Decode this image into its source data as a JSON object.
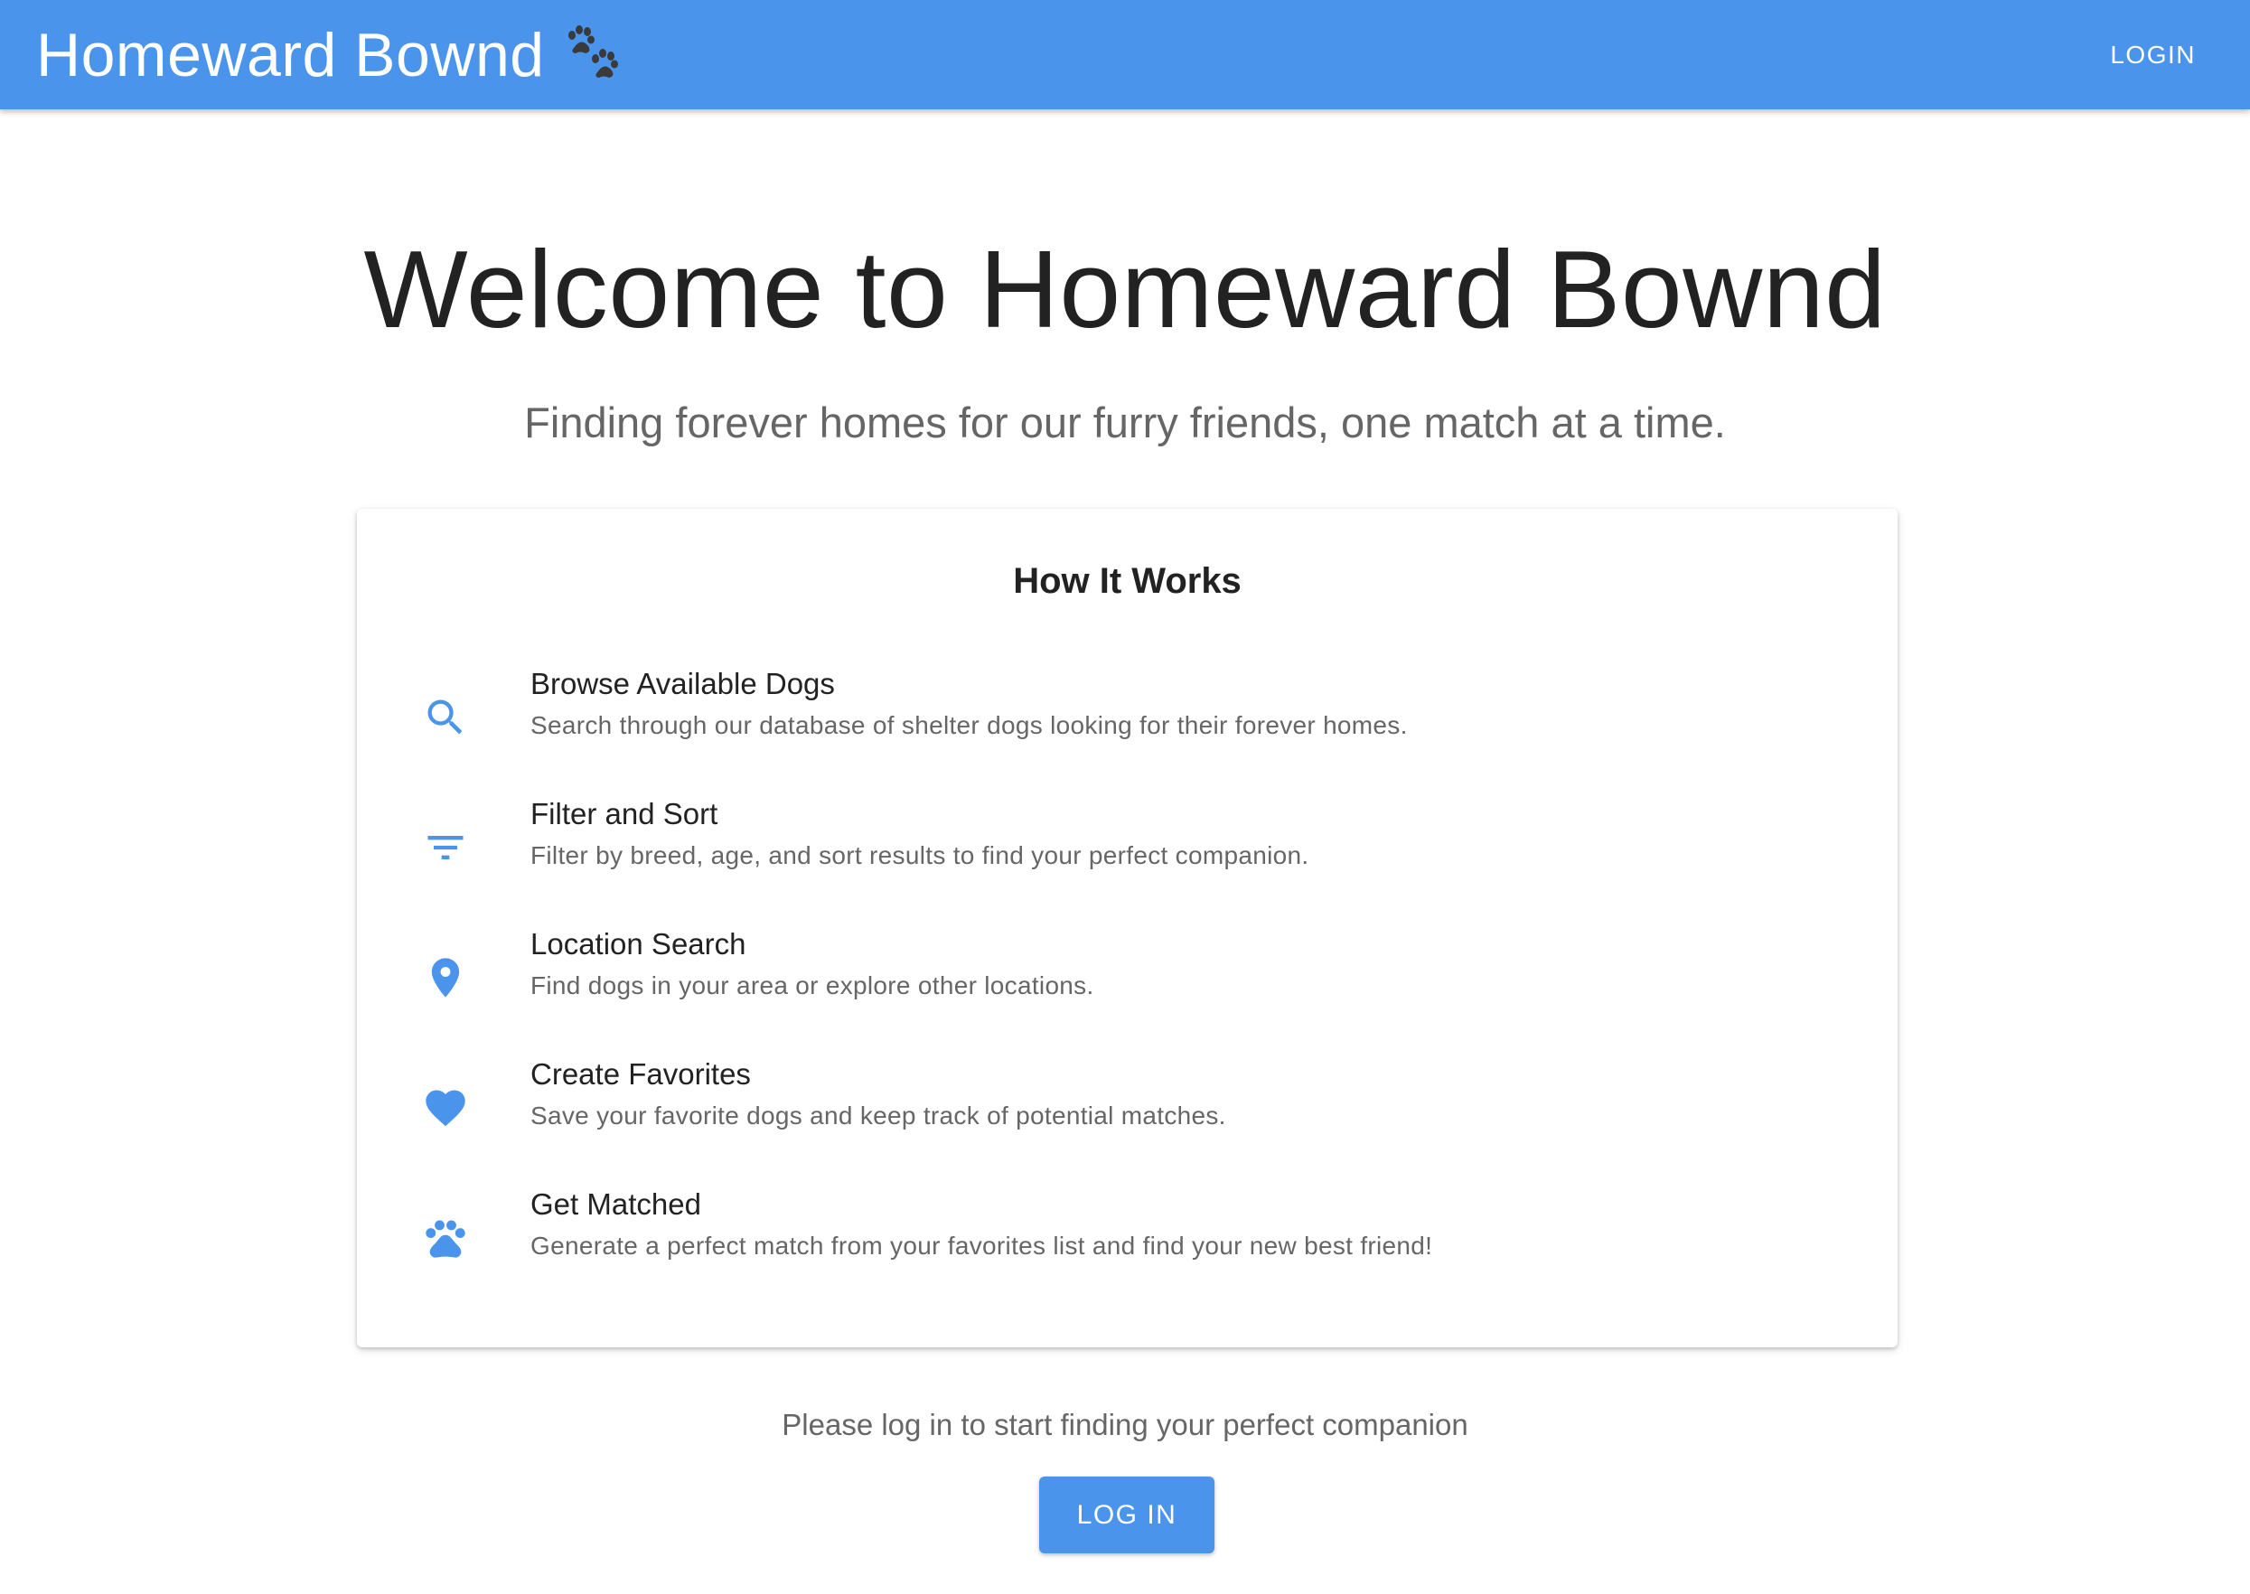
{
  "header": {
    "brand": "Homeward Bownd",
    "brand_icon": "paw-prints-icon",
    "login_label": "LOGIN",
    "bar_color": "#4a94ec"
  },
  "hero": {
    "title": "Welcome to Homeward Bownd",
    "subtitle": "Finding forever homes for our furry friends, one match at a time."
  },
  "how_it_works": {
    "title": "How It Works",
    "steps": [
      {
        "icon": "search-icon",
        "title": "Browse Available Dogs",
        "description": "Search through our database of shelter dogs looking for their forever homes."
      },
      {
        "icon": "filter-icon",
        "title": "Filter and Sort",
        "description": "Filter by breed, age, and sort results to find your perfect companion."
      },
      {
        "icon": "location-pin-icon",
        "title": "Location Search",
        "description": "Find dogs in your area or explore other locations."
      },
      {
        "icon": "heart-icon",
        "title": "Create Favorites",
        "description": "Save your favorite dogs and keep track of potential matches."
      },
      {
        "icon": "paw-icon",
        "title": "Get Matched",
        "description": "Generate a perfect match from your favorites list and find your new best friend!"
      }
    ]
  },
  "cta": {
    "prompt": "Please log in to start finding your perfect companion",
    "button_label": "LOG IN"
  },
  "colors": {
    "accent": "#4a94ec",
    "text_primary": "#222222",
    "text_secondary": "#666666"
  }
}
